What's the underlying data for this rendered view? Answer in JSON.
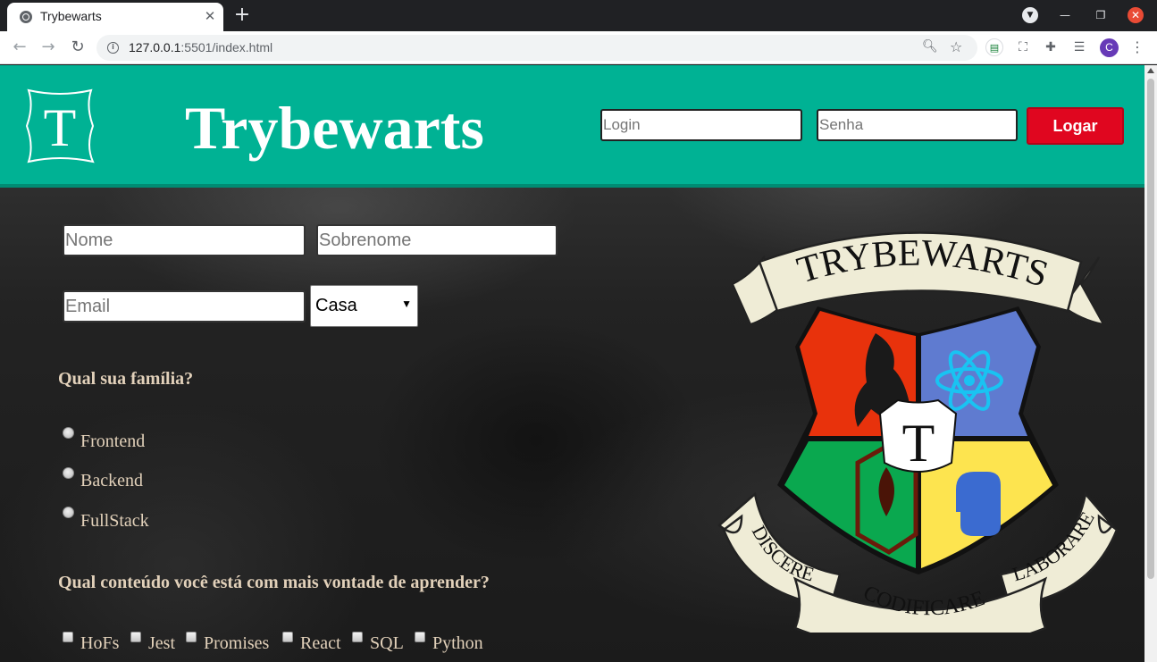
{
  "browser": {
    "tab_title": "Trybewarts",
    "tab_close": "✕",
    "new_tab": "+",
    "url_host": "127.0.0.1",
    "url_path": ":5501/index.html",
    "avatar_letter": "C"
  },
  "header": {
    "title": "Trybewarts",
    "logo_letter": "T",
    "login_placeholder": "Login",
    "senha_placeholder": "Senha",
    "logar_label": "Logar"
  },
  "form": {
    "nome_placeholder": "Nome",
    "sobrenome_placeholder": "Sobrenome",
    "email_placeholder": "Email",
    "casa_selected": "Casa",
    "familia_question": "Qual sua família?",
    "familia_options": [
      "Frontend",
      "Backend",
      "FullStack"
    ],
    "conteudo_question": "Qual conteúdo você está com mais vontade de aprender?",
    "conteudo_options": [
      "HoFs",
      "Jest",
      "Promises",
      "React",
      "SQL",
      "Python"
    ]
  },
  "crest": {
    "banner_top": "TRYBEWARTS",
    "center_letter": "T",
    "motto_left": "DISCERE",
    "motto_center": "CODIFICARE",
    "motto_right": "LABORARE"
  },
  "colors": {
    "header_bg": "#00b294",
    "logar_btn": "#e0061f",
    "label_text": "#e2d1ba"
  }
}
